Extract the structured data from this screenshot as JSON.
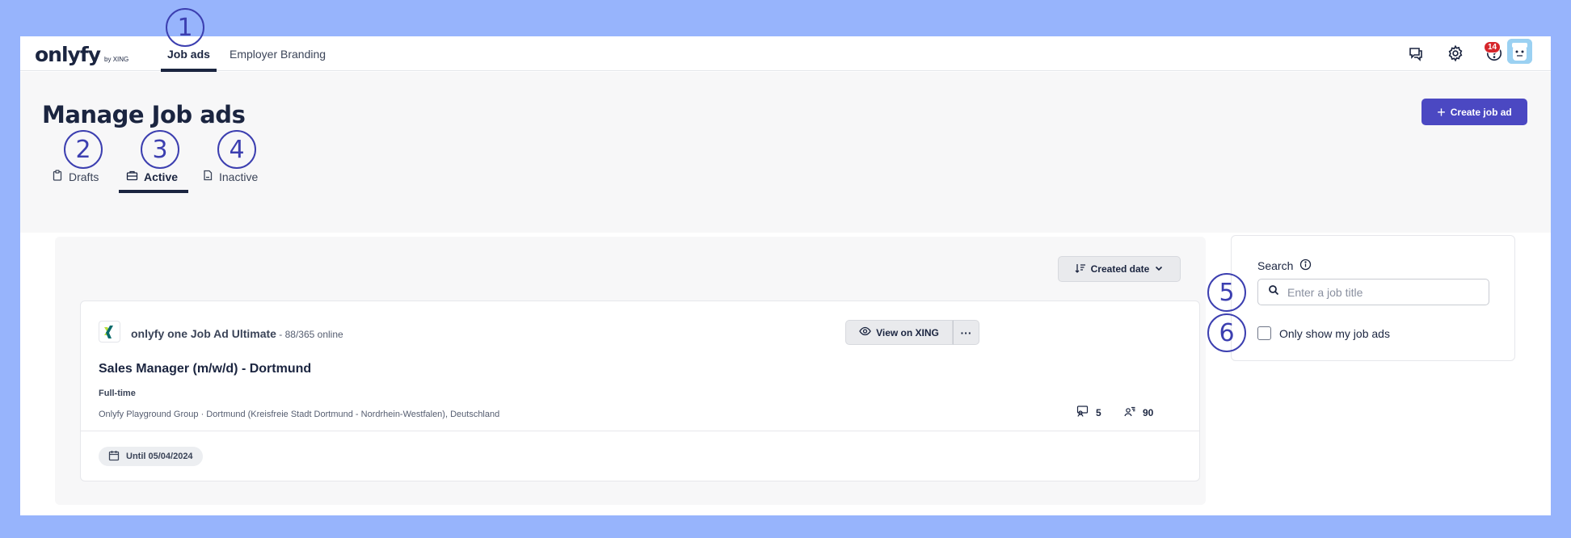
{
  "nav": {
    "logo": "onlyfy",
    "logo_sub": "by XING",
    "tabs": [
      {
        "label": "Job ads",
        "active": true
      },
      {
        "label": "Employer Branding",
        "active": false
      }
    ],
    "icons": [
      "chat-icon",
      "gear-icon",
      "help-icon"
    ],
    "notification_count": "14"
  },
  "header": {
    "title": "Manage Job ads",
    "create_button": "Create job ad",
    "subtabs": [
      {
        "label": "Drafts",
        "icon": "clipboard-icon"
      },
      {
        "label": "Active",
        "icon": "briefcase-icon",
        "active": true
      },
      {
        "label": "Inactive",
        "icon": "document-icon"
      }
    ]
  },
  "annotations": [
    "1",
    "2",
    "3",
    "4",
    "5",
    "6"
  ],
  "list": {
    "sort_label": "Created date",
    "job": {
      "product": "onlyfy one Job Ad Ultimate",
      "product_count": " - 88/365 online",
      "view_button": "View on XING",
      "more_button": "···",
      "title": "Sales Manager (m/w/d) - Dortmund",
      "type": "Full-time",
      "location": "Onlyfy Playground Group · Dortmund (Kreisfreie Stadt Dortmund - Nordrhein-Westfalen), Deutschland",
      "applications": "5",
      "candidates": "90",
      "until": "Until 05/04/2024"
    }
  },
  "search": {
    "label": "Search",
    "placeholder": "Enter a job title",
    "checkbox_label": "Only show my job ads",
    "checkbox_checked": false
  },
  "colors": {
    "accent": "#4b48c2",
    "navy": "#1b2540",
    "annotation": "#3c3fb0",
    "badge": "#d6262b"
  }
}
